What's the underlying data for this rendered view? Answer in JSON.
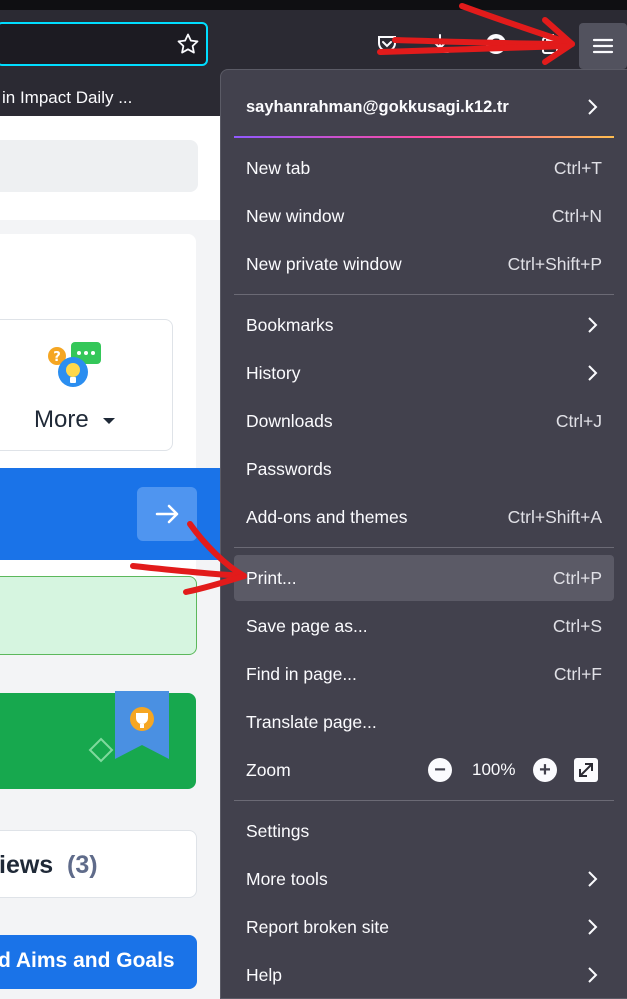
{
  "bookmarks": {
    "item": "in Impact Daily ..."
  },
  "page": {
    "more_label": "More",
    "views_label": "iews",
    "views_count": "(3)",
    "aims_label": "d Aims and Goals"
  },
  "menu": {
    "account": "sayhanrahman@gokkusagi.k12.tr",
    "items": [
      {
        "label": "New tab",
        "shortcut": "Ctrl+T"
      },
      {
        "label": "New window",
        "shortcut": "Ctrl+N"
      },
      {
        "label": "New private window",
        "shortcut": "Ctrl+Shift+P"
      },
      {
        "label": "Bookmarks",
        "shortcut": ""
      },
      {
        "label": "History",
        "shortcut": ""
      },
      {
        "label": "Downloads",
        "shortcut": "Ctrl+J"
      },
      {
        "label": "Passwords",
        "shortcut": ""
      },
      {
        "label": "Add-ons and themes",
        "shortcut": "Ctrl+Shift+A"
      },
      {
        "label": "Print...",
        "shortcut": "Ctrl+P"
      },
      {
        "label": "Save page as...",
        "shortcut": "Ctrl+S"
      },
      {
        "label": "Find in page...",
        "shortcut": "Ctrl+F"
      },
      {
        "label": "Translate page...",
        "shortcut": ""
      },
      {
        "label": "Zoom",
        "shortcut": ""
      },
      {
        "label": "Settings",
        "shortcut": ""
      },
      {
        "label": "More tools",
        "shortcut": ""
      },
      {
        "label": "Report broken site",
        "shortcut": ""
      },
      {
        "label": "Help",
        "shortcut": ""
      }
    ],
    "zoom_value": "100%"
  },
  "colors": {
    "accent_blue": "#1a73e8",
    "annotation_red": "#e21b1b",
    "menu_bg": "#42414d"
  }
}
